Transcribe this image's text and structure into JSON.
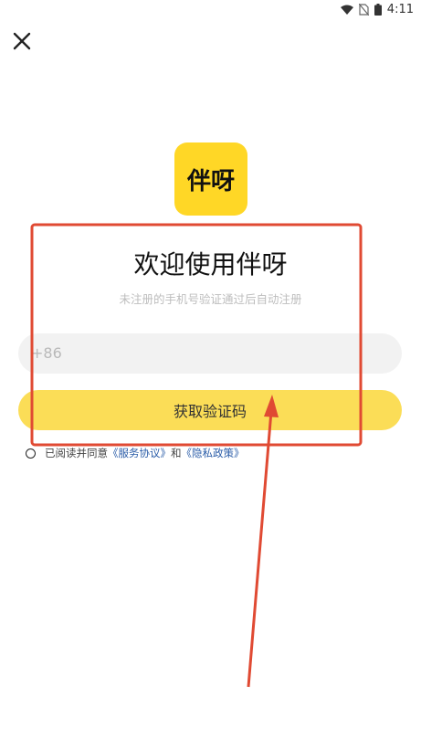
{
  "status_bar": {
    "time": "4:11"
  },
  "logo": {
    "text": "伴呀",
    "color": "#FFD726"
  },
  "welcome": {
    "title": "欢迎使用伴呀",
    "subtitle": "未注册的手机号验证通过后自动注册"
  },
  "phone_input": {
    "prefix": "+86"
  },
  "get_code_button": {
    "label": "获取验证码",
    "color": "#FBDD57"
  },
  "agreement": {
    "prefix": "已阅读并同意",
    "service_link": "《服务协议》",
    "and": "和",
    "privacy_link": "《隐私政策》",
    "checked": false
  },
  "annotation": {
    "color": "#E04A33"
  }
}
